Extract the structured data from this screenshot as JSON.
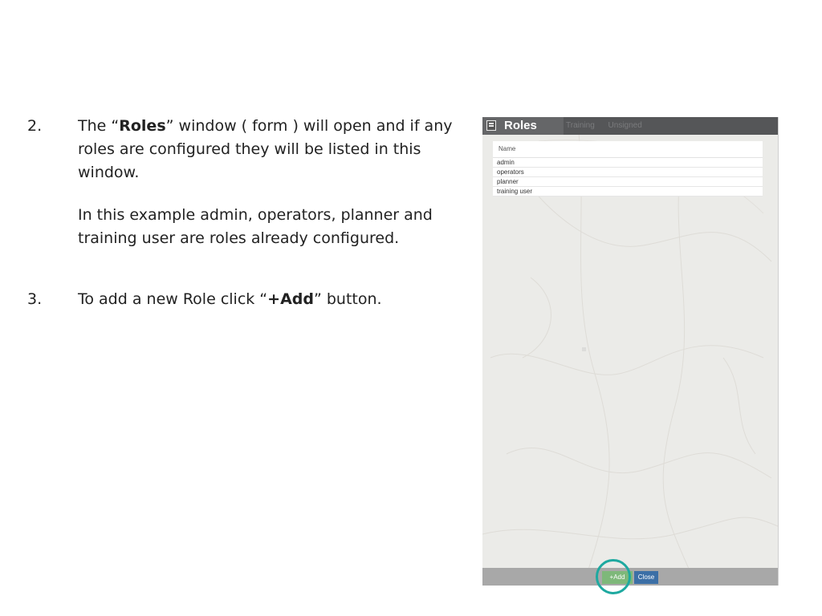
{
  "steps": [
    {
      "number": "2.",
      "text_pre": "The “",
      "bold": "Roles",
      "text_post": "” window ( form ) will open and if any roles are configured they will be listed in this window.",
      "note": "In this example admin, operators, planner and training user are roles already configured."
    },
    {
      "number": "3.",
      "text_pre": "To add a new Role click “",
      "bold": "+Add",
      "text_post": "” button."
    }
  ],
  "window": {
    "title": "Roles",
    "background_tabs": [
      "Training",
      "Unsigned"
    ],
    "table": {
      "header": "Name",
      "rows": [
        "admin",
        "operators",
        "planner",
        "training user"
      ]
    },
    "footer": {
      "add_label": "+Add",
      "close_label": "Close"
    }
  },
  "colors": {
    "title_bar": "#555658",
    "add_button": "#7eb87a",
    "close_button": "#3c6fa6",
    "highlight": "#1ea9a0"
  },
  "icons": {
    "title": "list-form-icon"
  }
}
